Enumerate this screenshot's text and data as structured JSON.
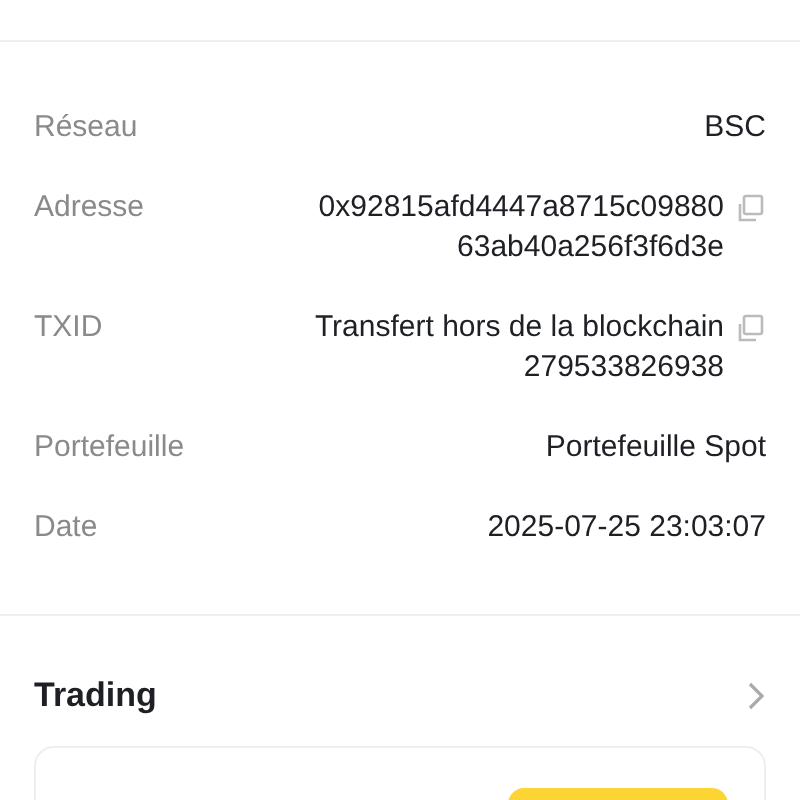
{
  "details": [
    {
      "label": "Réseau",
      "lines": [
        "BSC"
      ],
      "copyable": false
    },
    {
      "label": "Adresse",
      "lines": [
        "0x92815afd4447a8715c09880",
        "63ab40a256f3f6d3e"
      ],
      "copyable": true
    },
    {
      "label": "TXID",
      "lines": [
        "Transfert hors de la blockchain",
        "279533826938"
      ],
      "copyable": true
    },
    {
      "label": "Portefeuille",
      "lines": [
        "Portefeuille Spot"
      ],
      "copyable": false
    },
    {
      "label": "Date",
      "lines": [
        "2025-07-25 23:03:07"
      ],
      "copyable": false
    }
  ],
  "trading": {
    "title": "Trading"
  }
}
